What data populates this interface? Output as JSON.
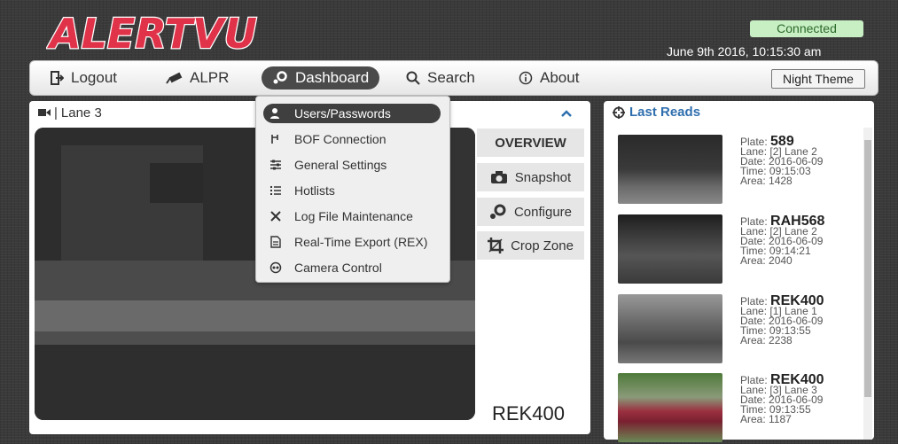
{
  "header": {
    "logo_text": "ALERTVU",
    "status": "Connected",
    "datetime": "June 9th 2016, 10:15:30 am"
  },
  "nav": {
    "logout": "Logout",
    "alpr": "ALPR",
    "dashboard": "Dashboard",
    "search": "Search",
    "about": "About",
    "night_theme": "Night Theme"
  },
  "dropdown": {
    "items": [
      "Users/Passwords",
      "BOF Connection",
      "General Settings",
      "Hotlists",
      "Log File Maintenance",
      "Real-Time Export (REX)",
      "Camera Control"
    ]
  },
  "camera": {
    "title": "Lane 3",
    "overview": "OVERVIEW",
    "snapshot": "Snapshot",
    "configure": "Configure",
    "crop_zone": "Crop Zone",
    "plate": "REK400"
  },
  "last_reads": {
    "title": "Last Reads",
    "plate_label": "Plate:",
    "lane_label": "Lane:",
    "date_label": "Date:",
    "time_label": "Time:",
    "area_label": "Area:",
    "reads": [
      {
        "plate": "589",
        "lane": "[2] Lane 2",
        "date": "2016-06-09",
        "time": "09:15:03",
        "area": "1428"
      },
      {
        "plate": "RAH568",
        "lane": "[2] Lane 2",
        "date": "2016-06-09",
        "time": "09:14:21",
        "area": "2040"
      },
      {
        "plate": "REK400",
        "lane": "[1] Lane 1",
        "date": "2016-06-09",
        "time": "09:13:55",
        "area": "2238"
      },
      {
        "plate": "REK400",
        "lane": "[3] Lane 3",
        "date": "2016-06-09",
        "time": "09:13:55",
        "area": "1187"
      }
    ]
  },
  "colors": {
    "brand_red": "#e0334a",
    "connected_bg": "#c8efc4",
    "link_blue": "#2f6fae"
  }
}
